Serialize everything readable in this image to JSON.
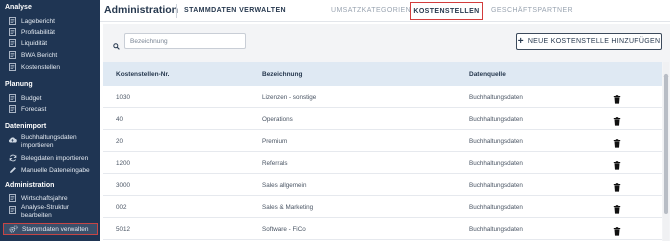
{
  "sidebar": {
    "sections": [
      {
        "title": "Analyse",
        "items": [
          {
            "label": "Lagebericht",
            "icon": "document-icon"
          },
          {
            "label": "Profitabilität",
            "icon": "document-icon"
          },
          {
            "label": "Liquidität",
            "icon": "document-icon"
          },
          {
            "label": "BWA Bericht",
            "icon": "document-icon"
          },
          {
            "label": "Kostenstellen",
            "icon": "document-icon"
          }
        ]
      },
      {
        "title": "Planung",
        "items": [
          {
            "label": "Budget",
            "icon": "document-icon"
          },
          {
            "label": "Forecast",
            "icon": "document-icon"
          }
        ]
      },
      {
        "title": "Datenimport",
        "items": [
          {
            "label": "Buchhaltungsdaten importieren",
            "icon": "cloud-upload-icon"
          },
          {
            "label": "Belegdaten importieren",
            "icon": "sync-icon"
          },
          {
            "label": "Manuelle Dateneingabe",
            "icon": "pencil-icon"
          }
        ]
      },
      {
        "title": "Administration",
        "items": [
          {
            "label": "Wirtschaftsjahre",
            "icon": "document-icon"
          },
          {
            "label": "Analyse-Struktur bearbeiten",
            "icon": "document-icon"
          },
          {
            "label": "Stammdaten verwalten",
            "icon": "gears-icon"
          }
        ]
      }
    ]
  },
  "header": {
    "title": "Administration",
    "main_tab": "STAMMDATEN VERWALTEN",
    "tabs": [
      "UMSATZKATEGORIEN",
      "KOSTENSTELLEN",
      "GESCHÄFTSPARTNER"
    ],
    "active_tab": "KOSTENSTELLEN"
  },
  "search": {
    "placeholder": "Bezeichnung",
    "value": ""
  },
  "add_button": {
    "label": "NEUE KOSTENSTELLE HINZUFÜGEN",
    "icon": "plus-icon"
  },
  "table": {
    "columns": [
      "Kostenstellen-Nr.",
      "Bezeichnung",
      "Datenquelle"
    ],
    "rows": [
      {
        "nr": "1030",
        "bezeichnung": "Lizenzen - sonstige",
        "quelle": "Buchhaltungsdaten"
      },
      {
        "nr": "40",
        "bezeichnung": "Operations",
        "quelle": "Buchhaltungsdaten"
      },
      {
        "nr": "20",
        "bezeichnung": "Premium",
        "quelle": "Buchhaltungsdaten"
      },
      {
        "nr": "1200",
        "bezeichnung": "Referrals",
        "quelle": "Buchhaltungsdaten"
      },
      {
        "nr": "3000",
        "bezeichnung": "Sales allgemein",
        "quelle": "Buchhaltungsdaten"
      },
      {
        "nr": "002",
        "bezeichnung": "Sales & Marketing",
        "quelle": "Buchhaltungsdaten"
      },
      {
        "nr": "5012",
        "bezeichnung": "Software - FiCo",
        "quelle": "Buchhaltungsdaten"
      }
    ],
    "row_action_icon": "trash-icon"
  },
  "colors": {
    "sidebar_bg": "#1f3553",
    "header_row_bg": "#dfe9f3",
    "active_tab_border": "#d23c3c"
  }
}
